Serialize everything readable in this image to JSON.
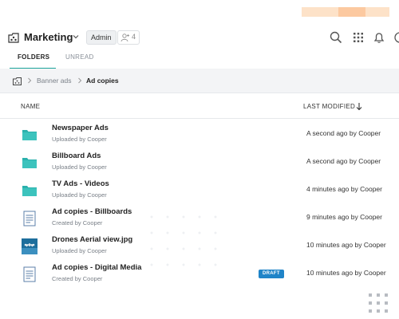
{
  "workspace": {
    "title": "Marketing",
    "role_badge": "Admin",
    "member_count": "4"
  },
  "tabs": [
    {
      "label": "FOLDERS",
      "active": true
    },
    {
      "label": "UNREAD",
      "active": false
    }
  ],
  "breadcrumb": {
    "parent": "Banner ads",
    "current": "Ad copies"
  },
  "table": {
    "columns": {
      "name": "NAME",
      "modified": "LAST MODIFIED"
    },
    "rows": [
      {
        "title": "Newspaper Ads",
        "subtitle": "Uploaded by  Cooper",
        "modified": "A second ago by Cooper",
        "icon": "folder-icon"
      },
      {
        "title": "Billboard Ads",
        "subtitle": "Uploaded by  Cooper",
        "modified": "A second ago by Cooper",
        "icon": "folder-icon"
      },
      {
        "title": "TV Ads - Videos",
        "subtitle": "Uploaded by  Cooper",
        "modified": "4 minutes ago by Cooper",
        "icon": "folder-icon"
      },
      {
        "title": "Ad copies - Billboards",
        "subtitle": "Created by  Cooper",
        "modified": "9 minutes ago by Cooper",
        "icon": "document-icon"
      },
      {
        "title": "Drones Aerial view.jpg",
        "subtitle": "Uploaded by  Cooper",
        "modified": "10 minutes ago by Cooper",
        "icon": "image-thumbnail-icon"
      },
      {
        "title": "Ad copies - Digital Media",
        "subtitle": "Created by  Cooper",
        "modified": "10 minutes ago by Cooper",
        "icon": "document-icon",
        "badge": "DRAFT"
      }
    ]
  },
  "colors": {
    "accent": "#1aa39a",
    "folder": "#2bb1ad",
    "draft": "#1f84c8",
    "deco_light": "#fde2c8",
    "deco_dark": "#fcc9a0"
  }
}
